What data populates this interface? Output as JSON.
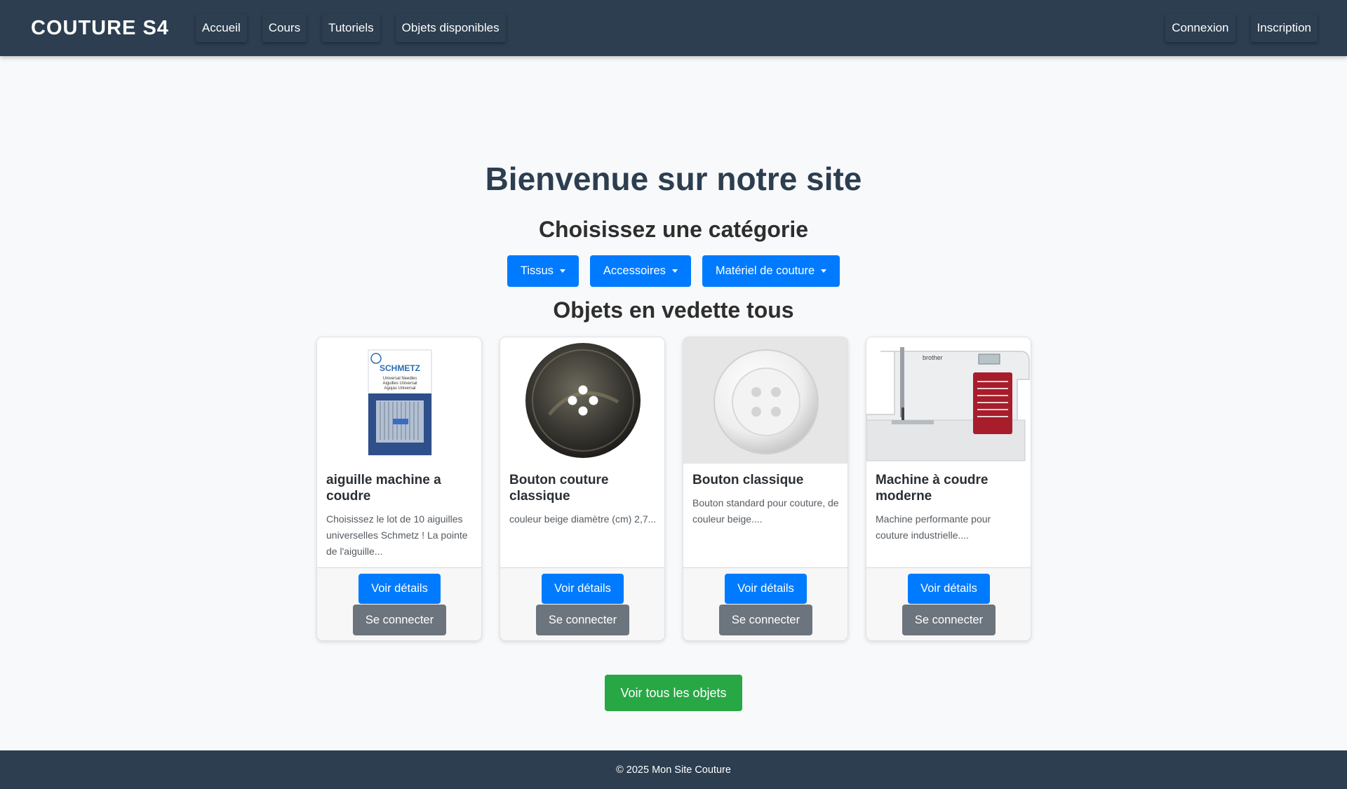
{
  "navbar": {
    "brand": "COUTURE S4",
    "links": [
      {
        "label": "Accueil"
      },
      {
        "label": "Cours"
      },
      {
        "label": "Tutoriels"
      },
      {
        "label": "Objets disponibles"
      }
    ],
    "auth": {
      "login": "Connexion",
      "register": "Inscription"
    }
  },
  "hero": {
    "title": "Bienvenue sur notre site",
    "category_heading": "Choisissez une catégorie",
    "categories": [
      {
        "label": "Tissus"
      },
      {
        "label": "Accessoires"
      },
      {
        "label": "Matériel de couture"
      }
    ]
  },
  "featured": {
    "heading": "Objets en vedette tous",
    "items": [
      {
        "title": "aiguille machine a coudre",
        "description": "Choisissez le lot de 10 aiguilles universelles Schmetz ! La pointe de l'aiguille...",
        "image": "needle-pack-image",
        "image_text": {
          "brand": "SCHMETZ",
          "line1": "Universal Needles",
          "line2": "Aiguilles Universal",
          "line3": "Agujas Universal"
        },
        "details_label": "Voir détails",
        "login_label": "Se connecter"
      },
      {
        "title": "Bouton couture classique",
        "description": "couleur beige diamètre (cm) 2,7...",
        "image": "dark-button-image",
        "details_label": "Voir détails",
        "login_label": "Se connecter"
      },
      {
        "title": "Bouton classique",
        "description": "Bouton standard pour couture, de couleur beige....",
        "image": "white-button-image",
        "details_label": "Voir détails",
        "login_label": "Se connecter"
      },
      {
        "title": "Machine à coudre moderne",
        "description": "Machine performante pour couture industrielle....",
        "image": "sewing-machine-image",
        "image_text": {
          "brand": "brother"
        },
        "details_label": "Voir détails",
        "login_label": "Se connecter"
      }
    ]
  },
  "cta": {
    "label": "Voir tous les objets"
  },
  "footer": {
    "text": "© 2025 Mon Site Couture"
  },
  "colors": {
    "navbar": "#2c3e50",
    "primary": "#007bff",
    "secondary": "#6c757d",
    "success": "#28a745",
    "background": "#f8f9fa"
  }
}
